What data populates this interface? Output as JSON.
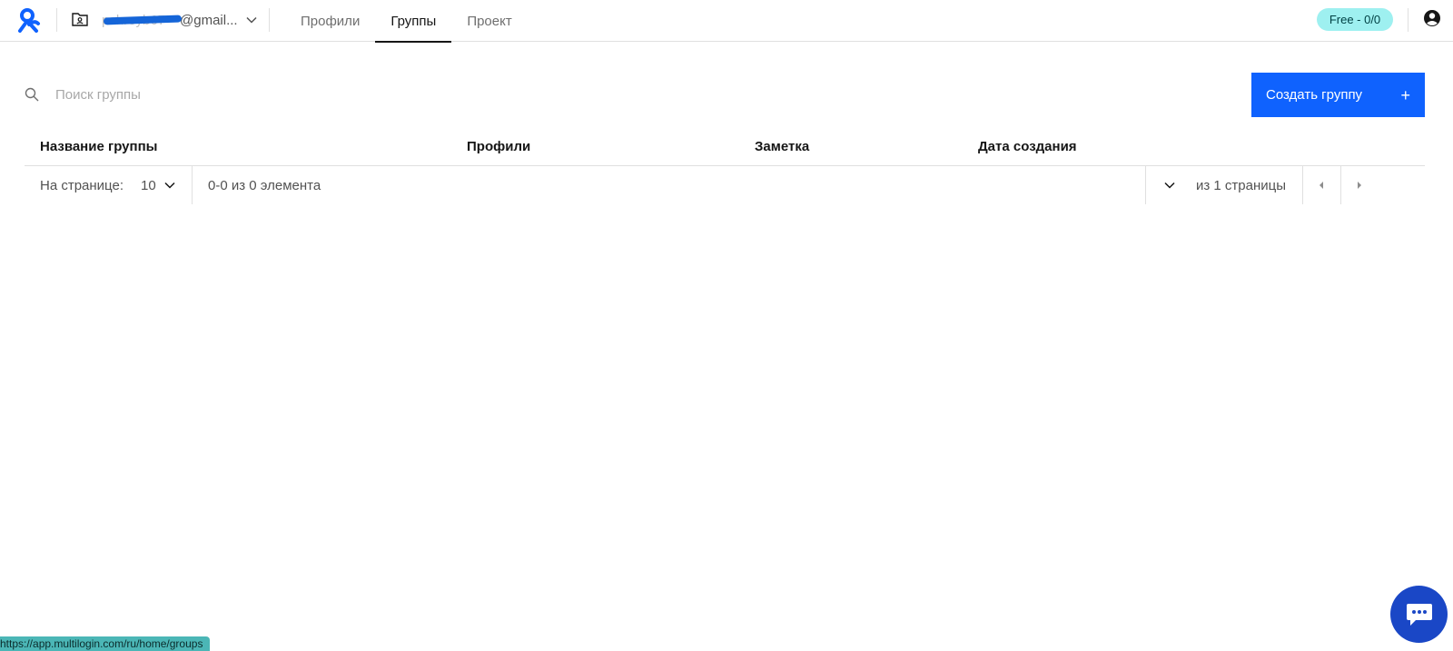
{
  "header": {
    "account": {
      "prefix": "pshreyb67",
      "email": "@gmail..."
    },
    "tabs": [
      {
        "label": "Профили",
        "active": false
      },
      {
        "label": "Группы",
        "active": true
      },
      {
        "label": "Проект",
        "active": false
      }
    ],
    "plan_badge": "Free - 0/0"
  },
  "toolbar": {
    "search_placeholder": "Поиск группы",
    "create_button_label": "Создать группу",
    "create_button_plus": "+"
  },
  "table": {
    "columns": [
      "Название группы",
      "Профили",
      "Заметка",
      "Дата создания"
    ]
  },
  "pagination": {
    "per_page_label": "На странице:",
    "per_page_value": "10",
    "range_text": "0-0 из 0 элемента",
    "pages_text": "из 1 страницы"
  },
  "status_url": "https://app.multilogin.com/ru/home/groups",
  "colors": {
    "accent": "#0f62fe",
    "badge_bg": "#9ef0f0",
    "chat_bg": "#1a47c6",
    "status_bar_bg": "#4bb6b6",
    "logo": "#0f62fe"
  },
  "icons": [
    "logo-icon",
    "folder-user-icon",
    "chevron-down-icon",
    "user-icon",
    "search-icon",
    "caret-left-icon",
    "caret-right-icon",
    "chat-icon"
  ]
}
